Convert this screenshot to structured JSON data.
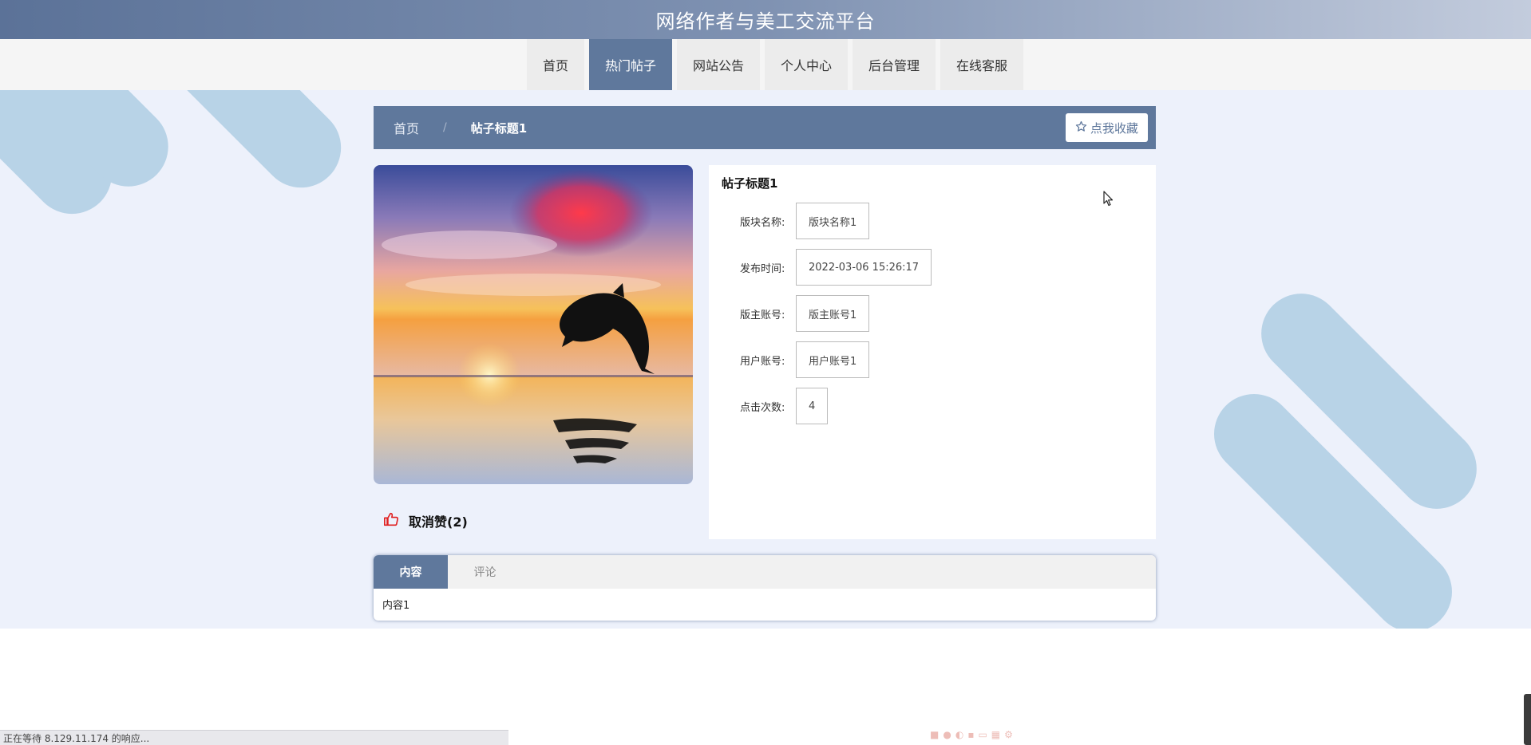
{
  "header": {
    "title": "网络作者与美工交流平台"
  },
  "nav": {
    "items": [
      {
        "label": "首页",
        "active": false
      },
      {
        "label": "热门帖子",
        "active": true
      },
      {
        "label": "网站公告",
        "active": false
      },
      {
        "label": "个人中心",
        "active": false
      },
      {
        "label": "后台管理",
        "active": false
      },
      {
        "label": "在线客服",
        "active": false
      }
    ]
  },
  "breadcrumb": {
    "home": "首页",
    "separator": "/",
    "current": "帖子标题1",
    "favorite_label": "点我收藏"
  },
  "post": {
    "title": "帖子标题1",
    "like_label": "取消赞(2)",
    "fields": [
      {
        "label": "版块名称:",
        "value": "版块名称1"
      },
      {
        "label": "发布时间:",
        "value": "2022-03-06 15:26:17"
      },
      {
        "label": "版主账号:",
        "value": "版主账号1"
      },
      {
        "label": "用户账号:",
        "value": "用户账号1"
      },
      {
        "label": "点击次数:",
        "value": "4"
      }
    ]
  },
  "tabs": {
    "items": [
      {
        "label": "内容",
        "active": true
      },
      {
        "label": "评论",
        "active": false
      }
    ],
    "content": "内容1"
  },
  "status_bar": {
    "text": "正在等待 8.129.11.174 的响应..."
  },
  "colors": {
    "primary": "#5f789c",
    "background": "#edf1fb",
    "decoration": "#b8d3e7",
    "like_icon": "#e02020"
  },
  "icons": {
    "favorite": "star-outline-icon",
    "like": "thumbs-up-icon"
  }
}
